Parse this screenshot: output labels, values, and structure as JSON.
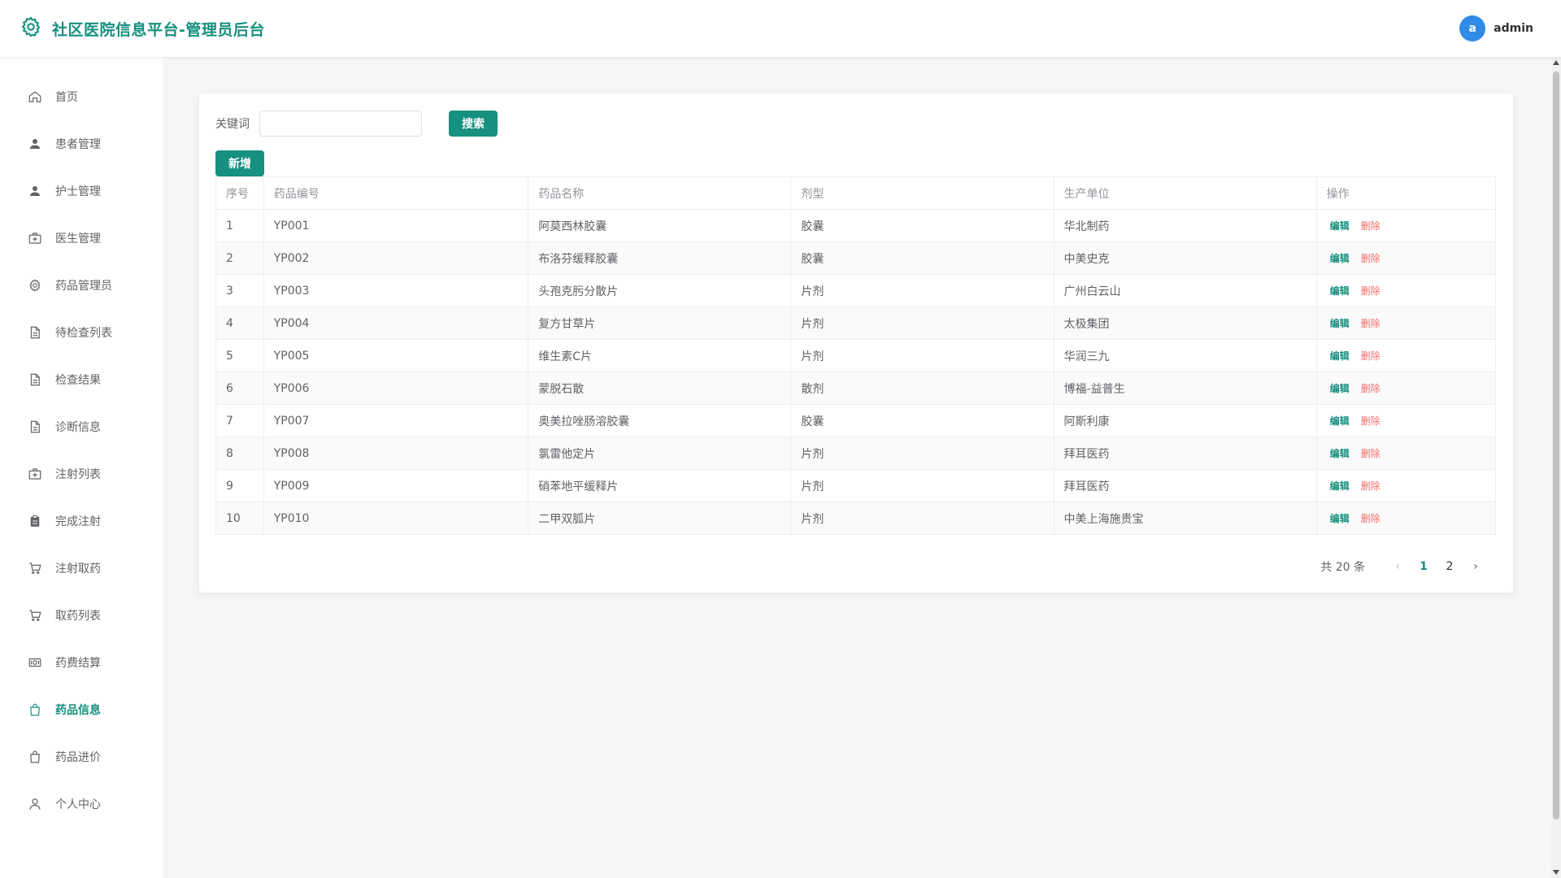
{
  "header": {
    "app_title": "社区医院信息平台-管理员后台",
    "logo_icon": "gear-icon",
    "avatar_letter": "a",
    "username": "admin"
  },
  "sidebar": {
    "items": [
      {
        "label": "首页",
        "icon": "home-icon"
      },
      {
        "label": "患者管理",
        "icon": "user-filled-icon"
      },
      {
        "label": "护士管理",
        "icon": "user-filled-icon"
      },
      {
        "label": "医生管理",
        "icon": "first-aid-kit-icon"
      },
      {
        "label": "药品管理员",
        "icon": "gear-icon"
      },
      {
        "label": "待检查列表",
        "icon": "document-icon"
      },
      {
        "label": "检查结果",
        "icon": "document-icon"
      },
      {
        "label": "诊断信息",
        "icon": "document-icon"
      },
      {
        "label": "注射列表",
        "icon": "first-aid-kit-icon"
      },
      {
        "label": "完成注射",
        "icon": "clipboard-icon"
      },
      {
        "label": "注射取药",
        "icon": "cart-icon"
      },
      {
        "label": "取药列表",
        "icon": "cart-icon"
      },
      {
        "label": "药费结算",
        "icon": "money-icon"
      },
      {
        "label": "药品信息",
        "icon": "bag-icon",
        "active": true
      },
      {
        "label": "药品进价",
        "icon": "bag-icon"
      },
      {
        "label": "个人中心",
        "icon": "user-icon"
      }
    ]
  },
  "search": {
    "label": "关键词",
    "value": "",
    "placeholder": "",
    "button_label": "搜索"
  },
  "toolbar": {
    "add_label": "新增"
  },
  "table": {
    "headers": [
      "序号",
      "药品编号",
      "药品名称",
      "剂型",
      "生产单位",
      "操作"
    ],
    "edit_label": "编辑",
    "delete_label": "删除",
    "rows": [
      [
        "1",
        "YP001",
        "阿莫西林胶囊",
        "胶囊",
        "华北制药"
      ],
      [
        "2",
        "YP002",
        "布洛芬缓释胶囊",
        "胶囊",
        "中美史克"
      ],
      [
        "3",
        "YP003",
        "头孢克肟分散片",
        "片剂",
        "广州白云山"
      ],
      [
        "4",
        "YP004",
        "复方甘草片",
        "片剂",
        "太极集团"
      ],
      [
        "5",
        "YP005",
        "维生素C片",
        "片剂",
        "华润三九"
      ],
      [
        "6",
        "YP006",
        "蒙脱石散",
        "散剂",
        "博福-益普生"
      ],
      [
        "7",
        "YP007",
        "奥美拉唑肠溶胶囊",
        "胶囊",
        "阿斯利康"
      ],
      [
        "8",
        "YP008",
        "氯雷他定片",
        "片剂",
        "拜耳医药"
      ],
      [
        "9",
        "YP009",
        "硝苯地平缓释片",
        "片剂",
        "拜耳医药"
      ],
      [
        "10",
        "YP010",
        "二甲双胍片",
        "片剂",
        "中美上海施贵宝"
      ]
    ]
  },
  "pagination": {
    "total_text": "共 20 条",
    "pages": [
      "1",
      "2"
    ],
    "current": "1"
  },
  "colors": {
    "accent": "#16907f",
    "danger": "#f56c6c",
    "avatar": "#2f8be6"
  }
}
